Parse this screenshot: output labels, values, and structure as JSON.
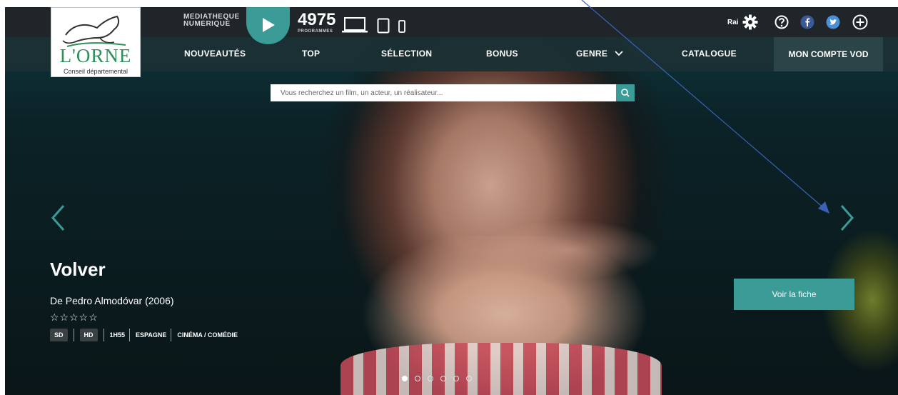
{
  "logo": {
    "brand": "L'ORNE",
    "subtitle": "Conseil départemental",
    "icon": "horse-logo-icon"
  },
  "header": {
    "mediatheque_line1": "MEDIATHEQUE",
    "mediatheque_line2": "NUMERIQUE",
    "program_count": "4975",
    "program_label": "PROGRAMMES",
    "user_short": "Rai"
  },
  "nav": {
    "items": [
      "NOUVEAUTÉS",
      "TOP",
      "SÉLECTION",
      "BONUS",
      "GENRE",
      "CATALOGUE"
    ],
    "account": "MON COMPTE VOD"
  },
  "search": {
    "placeholder": "Vous recherchez un film, un acteur, un réalisateur..."
  },
  "film": {
    "title": "Volver",
    "director": "De Pedro Almodóvar (2006)",
    "stars": "☆☆☆☆☆",
    "rating": 0,
    "tags": {
      "sd": "SD",
      "hd": "HD",
      "duration": "1H55",
      "country": "ESPAGNE",
      "genre": "CINÉMA / COMÉDIE"
    },
    "cta": "Voir la fiche"
  },
  "carousel": {
    "slides": 6,
    "active": 1
  },
  "colors": {
    "accent": "#3a9b97",
    "topbar": "#1f2528",
    "navbar": "#1b3034",
    "pointer": "#3a62b8"
  }
}
